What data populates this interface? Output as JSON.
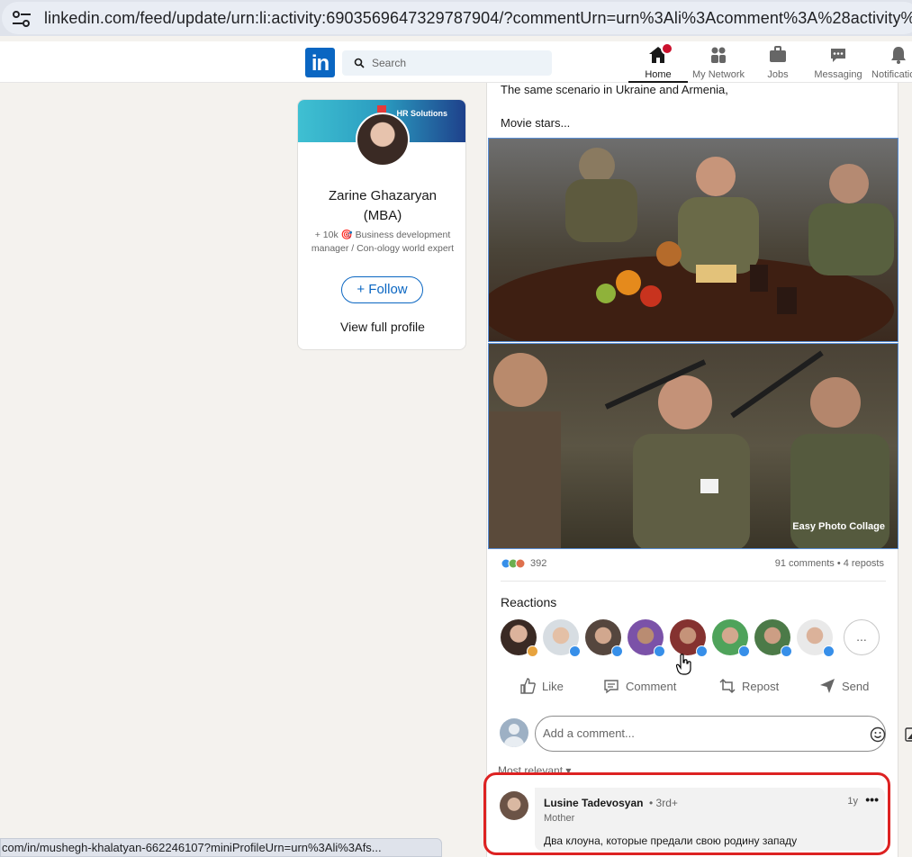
{
  "browser": {
    "url": "linkedin.com/feed/update/urn:li:activity:6903569647329787904/?commentUrn=urn%3Ali%3Acomment%3A%28activity%3A69",
    "status_url": "com/in/mushegh-khalatyan-662246107?miniProfileUrn=urn%3Ali%3Afs..."
  },
  "header": {
    "logo": "in",
    "search_placeholder": "Search",
    "nav": {
      "home": "Home",
      "network": "My Network",
      "jobs": "Jobs",
      "messaging": "Messaging",
      "notifications": "Notifications"
    }
  },
  "profile": {
    "banner_text": "HR Solutions",
    "name_line1": "Zarine Ghazaryan",
    "name_line2": "(MBA)",
    "headline": "+ 10k 🎯 Business development manager / Con-ology world expert",
    "follow_label": "+ Follow",
    "view_profile_label": "View full profile"
  },
  "post": {
    "text_line1": "The same scenario in Ukraine and Armenia,",
    "text_line2": "Movie stars...",
    "watermark": "Easy Photo Collage",
    "reaction_count": "392",
    "comments_reposts": "91 comments • 4 reposts",
    "reactions_title": "Reactions",
    "more_reactors": "...",
    "actions": {
      "like": "Like",
      "comment": "Comment",
      "repost": "Repost",
      "send": "Send"
    },
    "comment_placeholder": "Add a comment...",
    "sort_label": "Most relevant ▾"
  },
  "comment": {
    "author": "Lusine Tadevosyan",
    "degree": "• 3rd+",
    "role": "Mother",
    "time": "1y",
    "text": "Два клоуна, которые предали свою родину западу"
  },
  "colors": {
    "linkedin_blue": "#0a66c2",
    "highlight_red": "#dd2222",
    "like_blue": "#378fe9"
  }
}
